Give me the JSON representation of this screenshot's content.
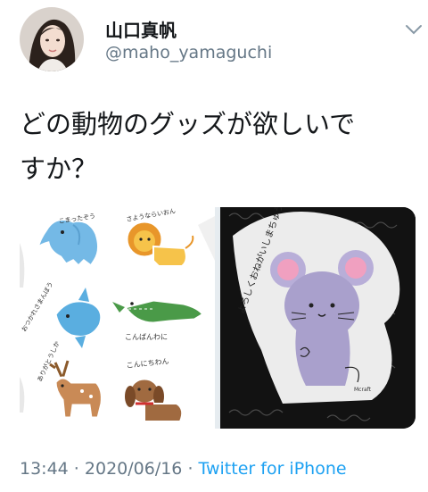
{
  "user": {
    "display_name": "山口真帆",
    "handle": "@maho_yamaguchi"
  },
  "tweet": {
    "text_lines": [
      "どの動物のグッズが欲しいで",
      "すか？"
    ]
  },
  "stickers": {
    "elephant": "こまったぞう",
    "lion": "さようならいおん",
    "manbo": "おつかれさまんぼう",
    "croc": "こんばんわに",
    "deer": "ありがとうしか",
    "dog": "こんにちわん",
    "mouse": "よろしくおねがいしまちゅう",
    "tag": "Mcraft"
  },
  "footer": {
    "time": "13:44",
    "sep1": " · ",
    "date": "2020/06/16",
    "sep2": " · ",
    "source": "Twitter for iPhone"
  },
  "colors": {
    "link": "#1da1f2",
    "secondary": "#657786",
    "text": "#14171a"
  }
}
